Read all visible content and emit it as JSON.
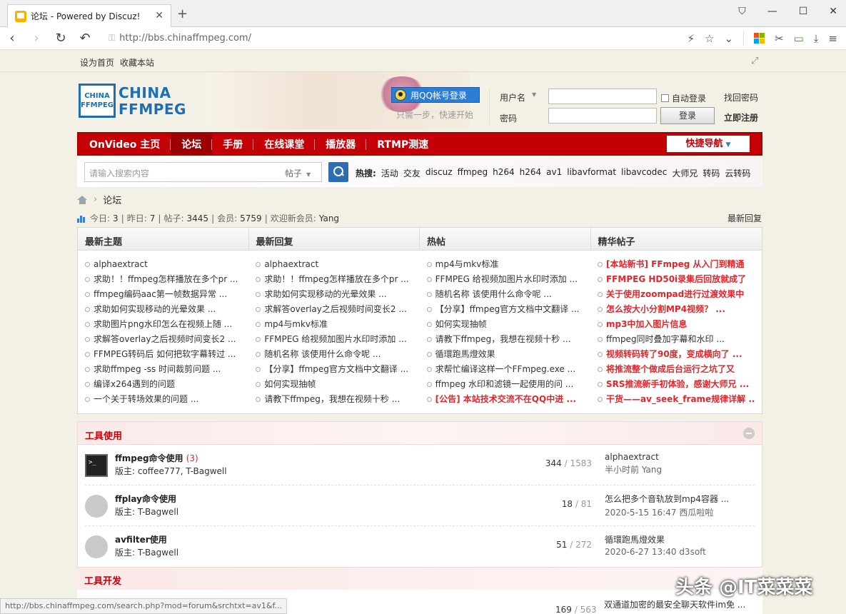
{
  "browser": {
    "tab_title": "论坛 - Powered by Discuz!",
    "url": "http://bbs.chinaffmpeg.com/",
    "status_url": "http://bbs.chinaffmpeg.com/search.php?mod=forum&srchtxt=av1&f..."
  },
  "topbar": {
    "set_home": "设为首页",
    "bookmark": "收藏本站"
  },
  "logo": {
    "box_top": "CHINA",
    "box_bottom": "FFMPEG",
    "text_top": "CHINA",
    "text_bottom": "FFMPEG"
  },
  "login": {
    "qq_button": "用QQ帐号登录",
    "qq_hint": "只需一步，快速开始",
    "username_label": "用户名",
    "password_label": "密码",
    "auto_login": "自动登录",
    "login_button": "登录",
    "find_password": "找回密码",
    "register": "立即注册"
  },
  "nav": {
    "items": [
      "OnVideo 主页",
      "论坛",
      "手册",
      "在线课堂",
      "播放器",
      "RTMP测速"
    ],
    "active": "论坛",
    "quick_nav": "快捷导航"
  },
  "search": {
    "placeholder": "请输入搜索内容",
    "scope": "帖子",
    "hot_label": "热搜:",
    "hot_terms": [
      "活动",
      "交友",
      "discuz",
      "ffmpeg",
      "h264",
      "h264",
      "av1",
      "libavformat",
      "libavcodec",
      "大师兄",
      "转码",
      "云转码"
    ]
  },
  "breadcrumb": {
    "current": "论坛"
  },
  "stats": {
    "today_label": "今日:",
    "today": "3",
    "yesterday_label": "昨日:",
    "yesterday": "7",
    "posts_label": "帖子:",
    "posts": "3445",
    "members_label": "会员:",
    "members": "5759",
    "welcome_label": "欢迎新会员:",
    "new_member": "Yang",
    "latest_reply": "最新回复"
  },
  "panels": [
    {
      "title": "最新主题",
      "items": [
        {
          "text": "alphaextract"
        },
        {
          "text": "求助！！ffmpeg怎样播放在多个pr ..."
        },
        {
          "text": "ffmpeg编码aac第一帧数据异常 ..."
        },
        {
          "text": "求助如何实现移动的光晕效果 ..."
        },
        {
          "text": "求助图片png水印怎么在视频上随 ..."
        },
        {
          "text": "求解答overlay之后视频时间变长2 ..."
        },
        {
          "text": "FFMPEG转码后 如何把软字幕转过 ..."
        },
        {
          "text": "求助ffmpeg -ss 时间裁剪问题 ..."
        },
        {
          "text": "编译x264遇到的问题"
        },
        {
          "text": "一个关于转场效果的问题 ..."
        }
      ]
    },
    {
      "title": "最新回复",
      "items": [
        {
          "text": "alphaextract"
        },
        {
          "text": "求助！！ffmpeg怎样播放在多个pr ..."
        },
        {
          "text": "求助如何实现移动的光晕效果 ..."
        },
        {
          "text": "求解答overlay之后视频时间变长2 ..."
        },
        {
          "text": "mp4与mkv标准"
        },
        {
          "text": "FFMPEG 给视频加图片水印时添加 ..."
        },
        {
          "text": "随机名称 该使用什么命令呢 ..."
        },
        {
          "text": "【分享】ffmpeg官方文档中文翻译 ..."
        },
        {
          "text": "如何实现抽帧"
        },
        {
          "text": "请教下ffmpeg，我想在视频十秒 ..."
        }
      ]
    },
    {
      "title": "热帖",
      "items": [
        {
          "text": "mp4与mkv标准"
        },
        {
          "text": "FFMPEG 给视频加图片水印时添加 ..."
        },
        {
          "text": "随机名称 该使用什么命令呢 ..."
        },
        {
          "text": "【分享】ffmpeg官方文档中文翻译 ..."
        },
        {
          "text": "如何实现抽帧"
        },
        {
          "text": "请教下ffmpeg，我想在视频十秒 ..."
        },
        {
          "text": "循環跑馬燈效果"
        },
        {
          "text": "求帮忙编译这样一个FFmpeg.exe ..."
        },
        {
          "text": "ffmpeg 水印和滤镜一起使用的问 ..."
        },
        {
          "text": "[公告] 本站技术交流不在QQ中进 ...",
          "red": true
        }
      ]
    },
    {
      "title": "精华帖子",
      "items": [
        {
          "text": "[本站新书] FFmpeg 从入门到精通",
          "red": true
        },
        {
          "text": "FFMPEG HD50i录集后回放就成了",
          "red": true
        },
        {
          "text": "关于使用zoompad进行过渡效果中",
          "red": true
        },
        {
          "text": "怎么按大小分割MP4视频？ ...",
          "red": true
        },
        {
          "text": "mp3中加入图片信息",
          "red": true
        },
        {
          "text": "ffmpeg同时叠加字幕和水印 ..."
        },
        {
          "text": "视频转码转了90度，变成横向了 ...",
          "red": true
        },
        {
          "text": "将推流整个做成后台运行之坑了又",
          "red": true
        },
        {
          "text": "SRS推流新手初体验，感谢大师兄 ...",
          "red": true
        },
        {
          "text": "干货——av_seek_frame规律详解 ...",
          "red": true
        }
      ]
    }
  ],
  "forum_section": {
    "title": "工具使用",
    "forums": [
      {
        "name": "ffmpeg命令使用",
        "today": "(3)",
        "moderators": "版主: coffee777, T-Bagwell",
        "threads": "344",
        "posts": "/ 1583",
        "last_title": "alphaextract",
        "last_meta": "半小时前 Yang"
      },
      {
        "name": "ffplay命令使用",
        "today": "",
        "moderators": "版主: T-Bagwell",
        "threads": "18",
        "posts": "/ 81",
        "last_title": "怎么把多个音轨放到mp4容器 ...",
        "last_meta": "2020-5-15 16:47 西瓜啦啦"
      },
      {
        "name": "avfilter使用",
        "today": "",
        "moderators": "版主: T-Bagwell",
        "threads": "51",
        "posts": "/ 272",
        "last_title": "循環跑馬燈效果",
        "last_meta": "2020-6-27 13:40 d3soft"
      }
    ]
  },
  "forum_section2": {
    "title": "工具开发",
    "peek_threads": "169",
    "peek_posts": "/ 563",
    "peek_last_title": "双通道加密的最安全聊天软件im免 ..."
  },
  "watermark": "头条 @IT菜菜菜",
  "colors": {
    "nav_red": "#c40006",
    "brand_blue": "#1c6fb6",
    "hot_red": "#e2262b"
  }
}
